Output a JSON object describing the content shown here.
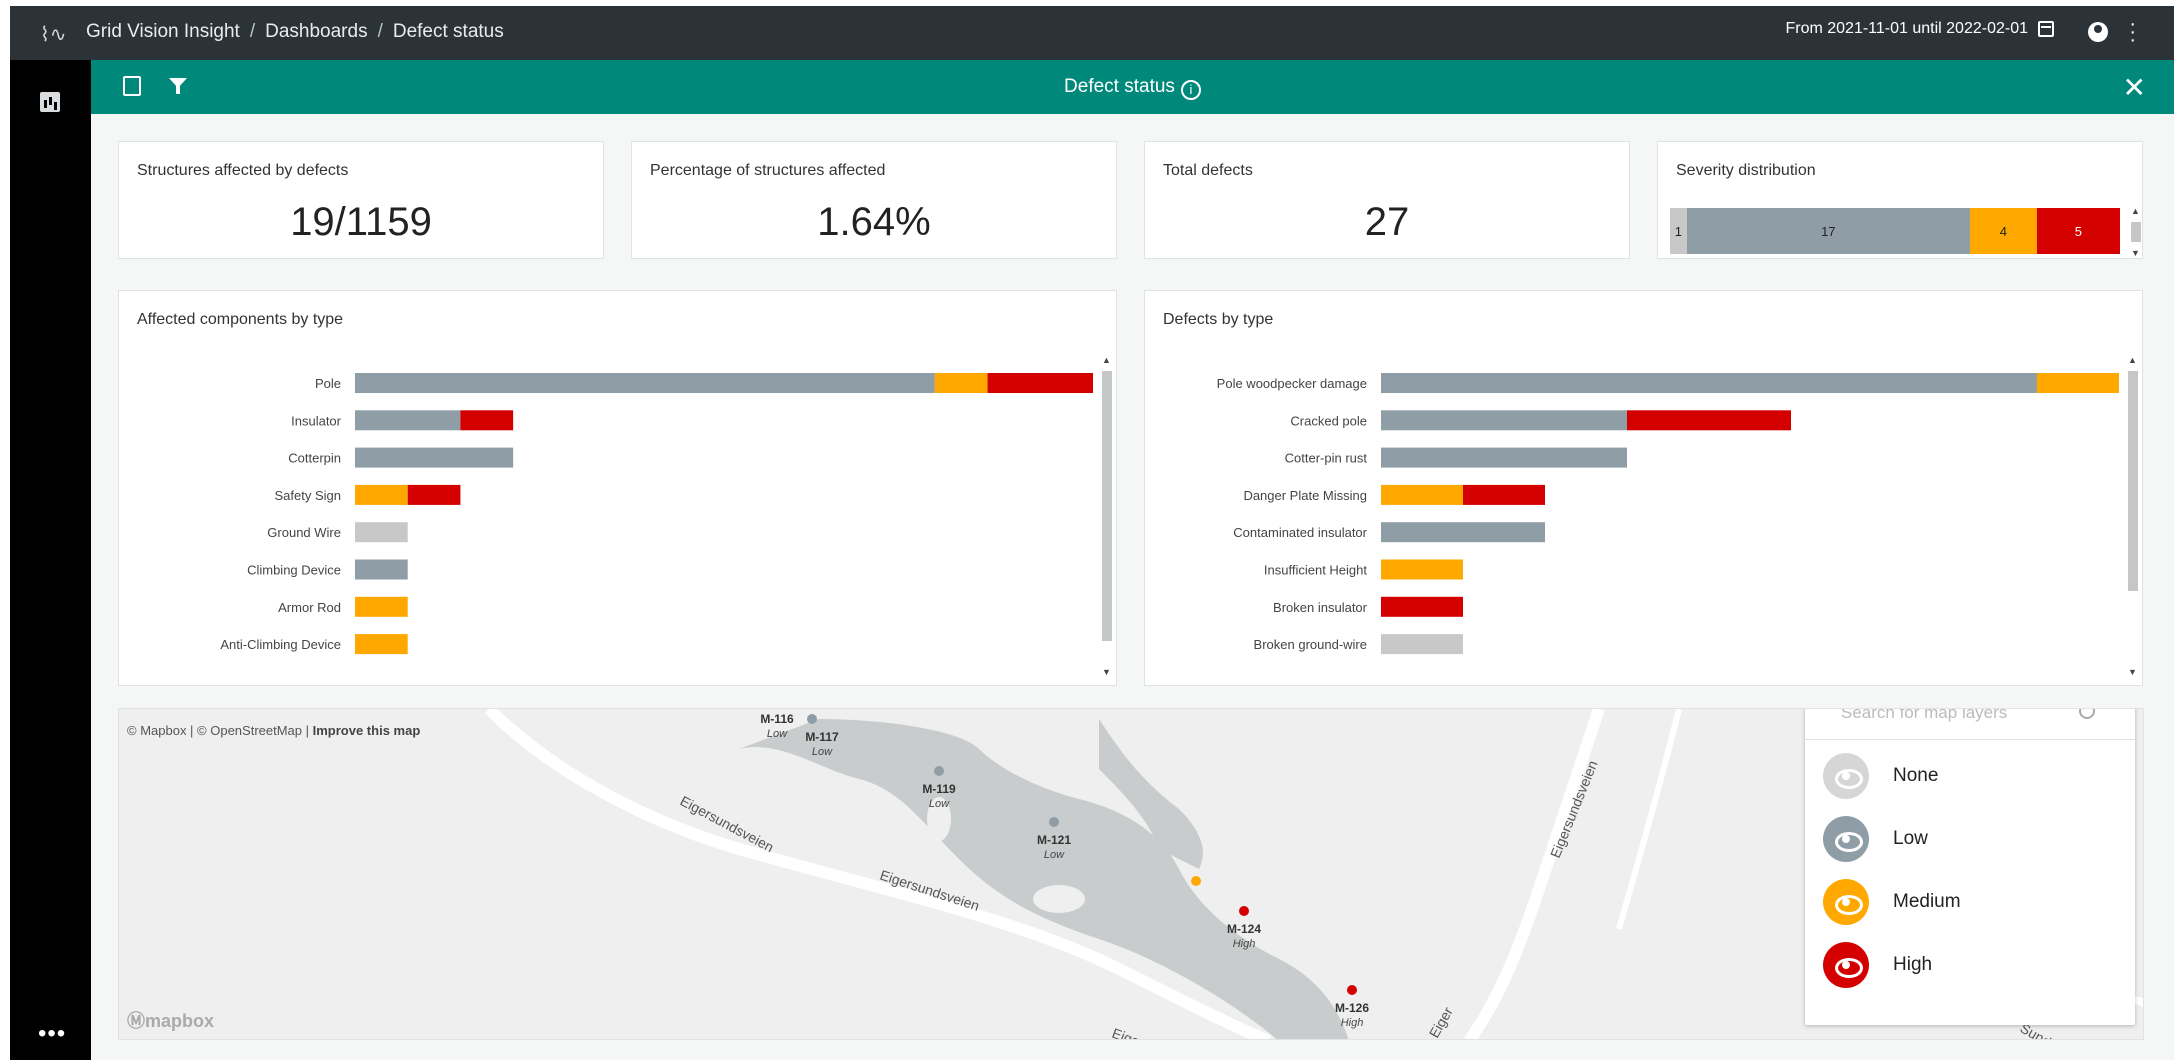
{
  "header": {
    "app_name": "Grid Vision Insight",
    "breadcrumb": [
      "Grid Vision Insight",
      "Dashboards",
      "Defect status"
    ],
    "date_range": "From 2021-11-01 until 2022-02-01"
  },
  "toolbar": {
    "title": "Defect status"
  },
  "kpis": {
    "structures_title": "Structures affected by defects",
    "structures_value": "19/1159",
    "percentage_title": "Percentage of structures affected",
    "percentage_value": "1.64%",
    "total_title": "Total defects",
    "total_value": "27",
    "severity_title": "Severity distribution"
  },
  "colors": {
    "none": "#c8c8c8",
    "low": "#8f9ea6",
    "medium": "#ffa800",
    "high": "#d40000",
    "teal": "#00897b"
  },
  "chart_data": [
    {
      "type": "bar",
      "stacked": true,
      "title": "Severity distribution",
      "categories": [
        ""
      ],
      "series": [
        {
          "name": "None",
          "values": [
            1
          ]
        },
        {
          "name": "Low",
          "values": [
            17
          ]
        },
        {
          "name": "Medium",
          "values": [
            4
          ]
        },
        {
          "name": "High",
          "values": [
            5
          ]
        }
      ]
    },
    {
      "type": "bar",
      "orientation": "horizontal",
      "stacked": true,
      "title": "Affected components by type",
      "categories": [
        "Pole",
        "Insulator",
        "Cotterpin",
        "Safety Sign",
        "Ground Wire",
        "Climbing Device",
        "Armor Rod",
        "Anti-Climbing Device"
      ],
      "series": [
        {
          "name": "None",
          "values": [
            0,
            0,
            0,
            0,
            1,
            0,
            0,
            0
          ]
        },
        {
          "name": "Low",
          "values": [
            11,
            2,
            3,
            0,
            0,
            1,
            0,
            0
          ]
        },
        {
          "name": "Medium",
          "values": [
            1,
            0,
            0,
            1,
            0,
            0,
            1,
            1
          ]
        },
        {
          "name": "High",
          "values": [
            2,
            1,
            0,
            1,
            0,
            0,
            0,
            0
          ]
        }
      ]
    },
    {
      "type": "bar",
      "orientation": "horizontal",
      "stacked": true,
      "title": "Defects by type",
      "categories": [
        "Pole woodpecker damage",
        "Cracked pole",
        "Cotter-pin rust",
        "Danger Plate Missing",
        "Contaminated insulator",
        "Insufficient Height",
        "Broken insulator",
        "Broken ground-wire"
      ],
      "series": [
        {
          "name": "None",
          "values": [
            0,
            0,
            0,
            0,
            0,
            0,
            0,
            1
          ]
        },
        {
          "name": "Low",
          "values": [
            8,
            3,
            3,
            0,
            2,
            0,
            0,
            0
          ]
        },
        {
          "name": "Medium",
          "values": [
            1,
            0,
            0,
            1,
            0,
            1,
            0,
            0
          ]
        },
        {
          "name": "High",
          "values": [
            0,
            2,
            0,
            1,
            0,
            0,
            1,
            0
          ]
        }
      ]
    }
  ],
  "map": {
    "attribution_prefix": "© Mapbox | © OpenStreetMap |",
    "attribution_link": "Improve this map",
    "logo": "mapbox",
    "search_placeholder": "Search for map layers",
    "roads": [
      "Eigersundsveien",
      "Eigersundsveien",
      "Eigersundsveien",
      "Eiger",
      "Eiger",
      "Sund"
    ],
    "markers": [
      {
        "id": "M-116",
        "severity": "Low"
      },
      {
        "id": "M-117",
        "severity": "Low"
      },
      {
        "id": "M-119",
        "severity": "Low"
      },
      {
        "id": "M-121",
        "severity": "Low"
      },
      {
        "id": "M-124",
        "severity": "High"
      },
      {
        "id": "M-126",
        "severity": "High"
      }
    ],
    "legend": [
      {
        "label": "None",
        "icon": "eye-icon"
      },
      {
        "label": "Low",
        "icon": "eye-icon"
      },
      {
        "label": "Medium",
        "icon": "eye-icon"
      },
      {
        "label": "High",
        "icon": "eye-icon"
      }
    ]
  }
}
